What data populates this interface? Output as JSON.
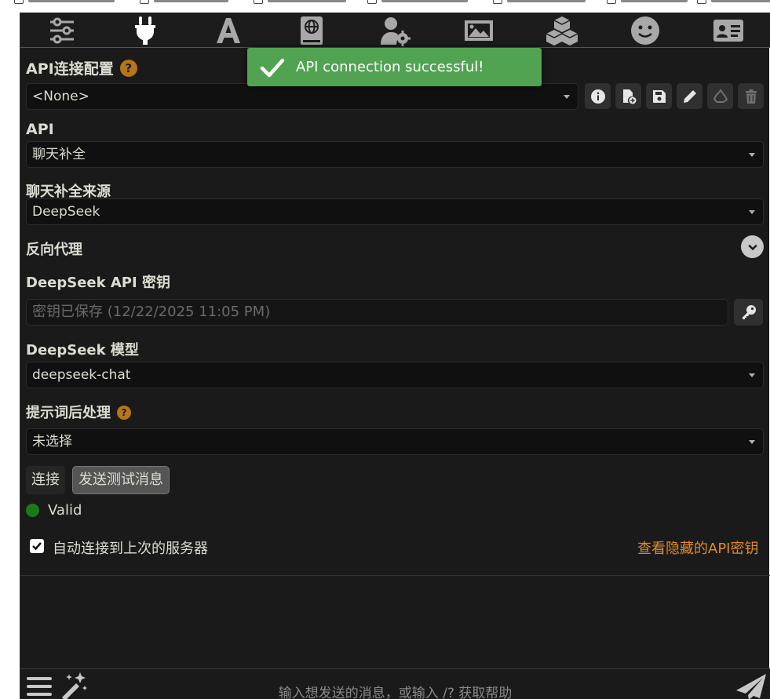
{
  "toast": {
    "message": "API connection successful!"
  },
  "nav": {
    "items": [
      {
        "id": "ai-response-config",
        "icon": "sliders-icon"
      },
      {
        "id": "api-connections",
        "icon": "plug-icon",
        "active": true
      },
      {
        "id": "ai-response-formatting",
        "icon": "font-icon"
      },
      {
        "id": "world-info",
        "icon": "book-globe-icon"
      },
      {
        "id": "user-settings",
        "icon": "user-gear-icon"
      },
      {
        "id": "backgrounds",
        "icon": "image-icon"
      },
      {
        "id": "extensions",
        "icon": "cubes-icon"
      },
      {
        "id": "persona",
        "icon": "face-smile-icon"
      },
      {
        "id": "character-management",
        "icon": "id-card-icon"
      }
    ]
  },
  "api_profile": {
    "label": "API连接配置",
    "help": "?",
    "selected": "<None>"
  },
  "api": {
    "label": "API",
    "selected": "聊天补全"
  },
  "chat_source": {
    "label": "聊天补全来源",
    "selected": "DeepSeek"
  },
  "reverse_proxy": {
    "label": "反向代理"
  },
  "api_key": {
    "label": "DeepSeek API 密钥",
    "placeholder": "密钥已保存 (12/22/2025 11:05 PM)"
  },
  "model": {
    "label": "DeepSeek 模型",
    "selected": "deepseek-chat"
  },
  "prompt_post": {
    "label": "提示词后处理",
    "help": "?",
    "selected": "未选择"
  },
  "buttons": {
    "connect": "连接",
    "send_test": "发送测试消息"
  },
  "status": {
    "text": "Valid",
    "color": "#1a7a1a"
  },
  "auto_connect": {
    "label": "自动连接到上次的服务器",
    "checked": true
  },
  "view_hidden_keys": "查看隐藏的API密钥",
  "chat_input": {
    "placeholder": "输入想发送的消息，或输入 /? 获取帮助"
  },
  "colors": {
    "panel_bg": "#1a1a1a",
    "toast_bg": "#51a351",
    "help_icon": "#b8741a",
    "link": "#e08a2a"
  }
}
